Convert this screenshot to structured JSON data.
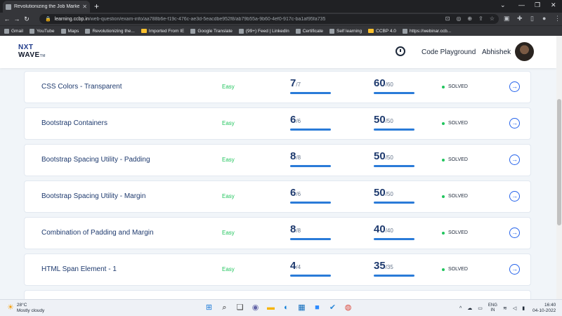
{
  "browser": {
    "tab_title": "Revolutionizing the Job Market | NxtWave",
    "url_host": "learning.ccbp.in",
    "url_path": "/web-question/exam-info/aa788b6e-f19c-476c-ae3d-5eacdbe952f8/ab79b55a-9b60-4ef0-917c-ba1af95fa735",
    "bookmarks": [
      {
        "label": "Gmail",
        "icon": "gmail-icon"
      },
      {
        "label": "YouTube",
        "icon": "youtube-icon"
      },
      {
        "label": "Maps",
        "icon": "maps-icon"
      },
      {
        "label": "Revolutionizing the...",
        "icon": "site-icon"
      },
      {
        "label": "Imported From IE",
        "icon": "folder-icon"
      },
      {
        "label": "Google Translate",
        "icon": "translate-icon"
      },
      {
        "label": "(99+) Feed | LinkedIn",
        "icon": "linkedin-icon"
      },
      {
        "label": "Certificate",
        "icon": "site-icon"
      },
      {
        "label": "Self learning",
        "icon": "site-icon"
      },
      {
        "label": "CCBP 4.0",
        "icon": "folder-icon"
      },
      {
        "label": "https://webinar.ccb...",
        "icon": "site-icon"
      }
    ]
  },
  "header": {
    "logo_line1": "NXT",
    "logo_line2": "WAVE",
    "logo_tm": "TM",
    "code_playground": "Code Playground",
    "username": "Abhishek"
  },
  "questions": [
    {
      "title": "CSS Colors - Transparent",
      "difficulty": "Easy",
      "attempts": "7",
      "attempts_total": "/7",
      "score": "60",
      "score_total": "/60",
      "status": "SOLVED"
    },
    {
      "title": "Bootstrap Containers",
      "difficulty": "Easy",
      "attempts": "6",
      "attempts_total": "/6",
      "score": "50",
      "score_total": "/50",
      "status": "SOLVED"
    },
    {
      "title": "Bootstrap Spacing Utility - Padding",
      "difficulty": "Easy",
      "attempts": "8",
      "attempts_total": "/8",
      "score": "50",
      "score_total": "/50",
      "status": "SOLVED"
    },
    {
      "title": "Bootstrap Spacing Utility - Margin",
      "difficulty": "Easy",
      "attempts": "6",
      "attempts_total": "/6",
      "score": "50",
      "score_total": "/50",
      "status": "SOLVED"
    },
    {
      "title": "Combination of Padding and Margin",
      "difficulty": "Easy",
      "attempts": "8",
      "attempts_total": "/8",
      "score": "40",
      "score_total": "/40",
      "status": "SOLVED"
    },
    {
      "title": "HTML Span Element - 1",
      "difficulty": "Easy",
      "attempts": "4",
      "attempts_total": "/4",
      "score": "35",
      "score_total": "/35",
      "status": "SOLVED"
    }
  ],
  "taskbar": {
    "temperature": "28°C",
    "weather": "Mostly cloudy",
    "lang_line1": "ENG",
    "lang_line2": "IN",
    "time": "16:40",
    "date": "04-10-2022"
  }
}
